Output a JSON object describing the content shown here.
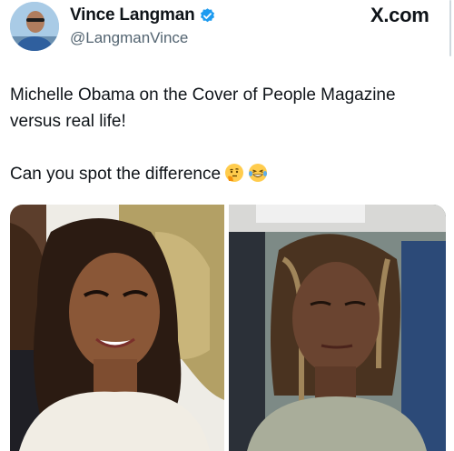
{
  "tweet": {
    "author": {
      "display_name": "Vince Langman",
      "handle": "@LangmanVince",
      "verified": true,
      "avatar_icon": "profile-photo"
    },
    "source_label": "X.com",
    "text_line1": "Michelle Obama on the Cover of People Magazine versus real life!",
    "text_line2": "Can you spot the difference",
    "emojis": [
      "thinking-face-icon",
      "laughing-with-tears-icon"
    ],
    "media": [
      {
        "icon": "magazine-cover-photo"
      },
      {
        "icon": "candid-street-photo"
      }
    ]
  },
  "colors": {
    "text": "#0f1419",
    "secondary_text": "#536471",
    "verified_blue": "#1d9bf0"
  }
}
